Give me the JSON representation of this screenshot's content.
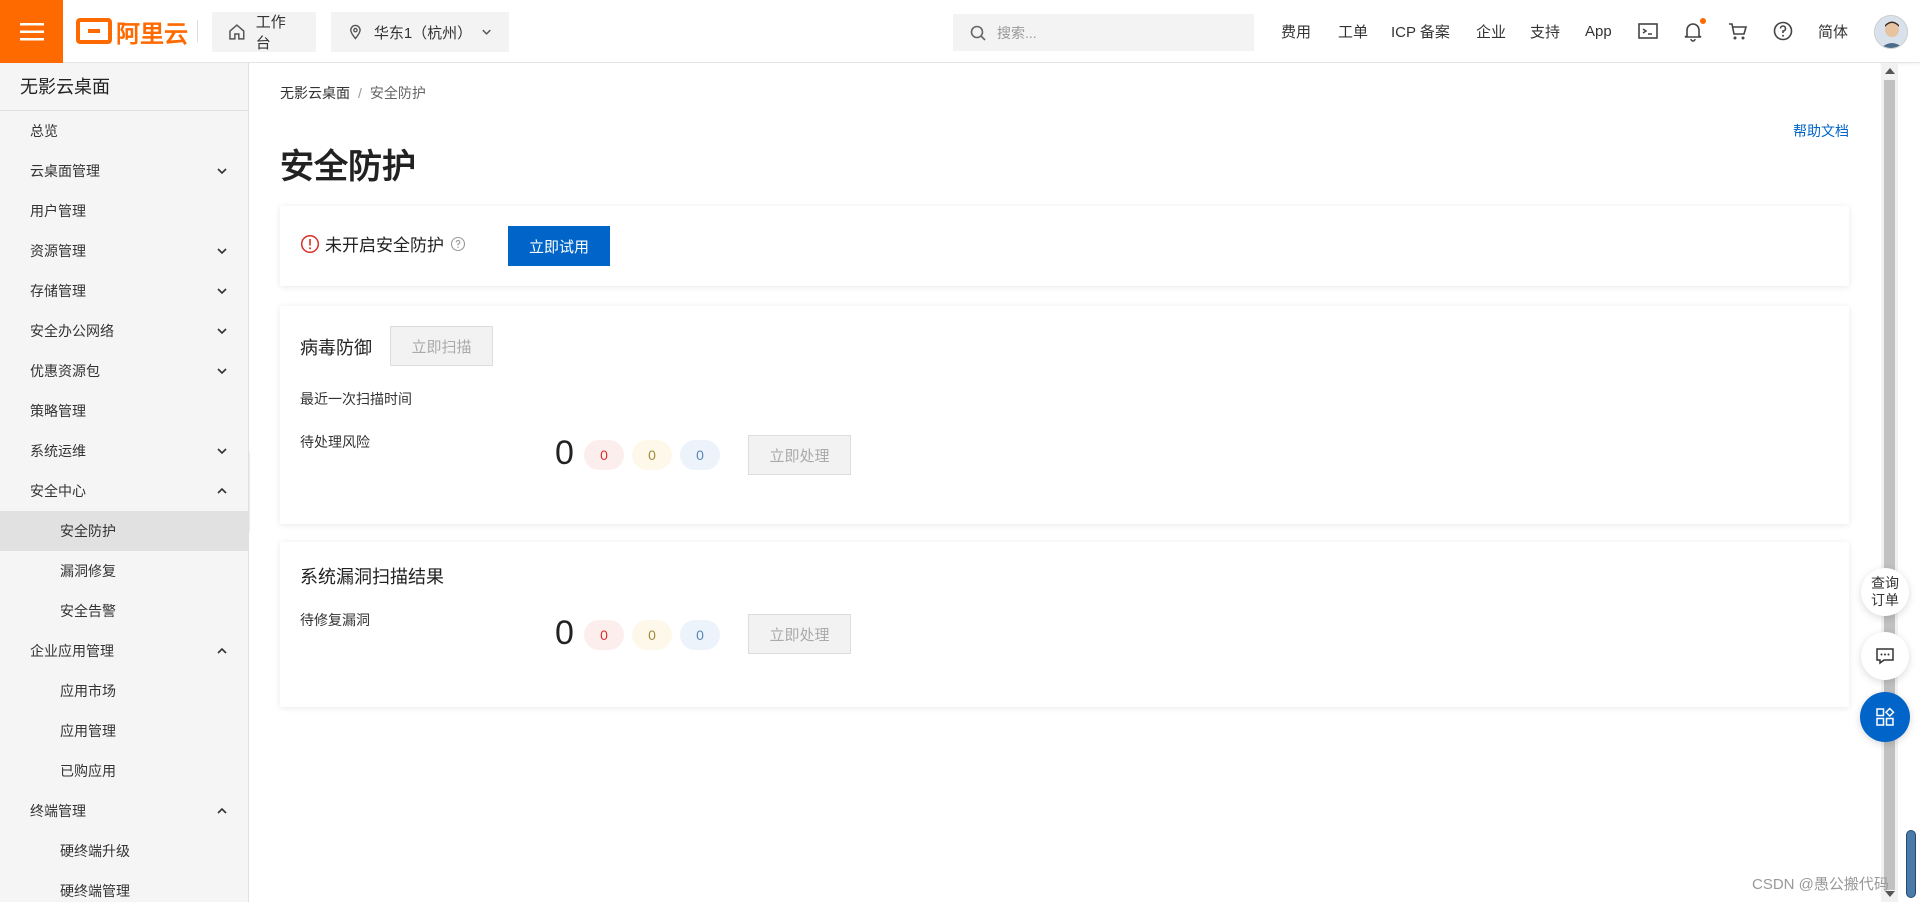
{
  "topbar": {
    "logo_text": "阿里云",
    "workbench_label": "工作台",
    "region_label": "华东1（杭州）",
    "search_placeholder": "搜索...",
    "nav": [
      "费用",
      "工单",
      "ICP 备案",
      "企业",
      "支持",
      "App"
    ],
    "lang_label": "简体",
    "accent_color": "#ff6a00"
  },
  "sidebar": {
    "title": "无影云桌面",
    "items": [
      {
        "label": "总览",
        "arrow": ""
      },
      {
        "label": "云桌面管理",
        "arrow": "down"
      },
      {
        "label": "用户管理",
        "arrow": ""
      },
      {
        "label": "资源管理",
        "arrow": "down"
      },
      {
        "label": "存储管理",
        "arrow": "down"
      },
      {
        "label": "安全办公网络",
        "arrow": "down"
      },
      {
        "label": "优惠资源包",
        "arrow": "down"
      },
      {
        "label": "策略管理",
        "arrow": ""
      },
      {
        "label": "系统运维",
        "arrow": "down"
      },
      {
        "label": "安全中心",
        "arrow": "up"
      },
      {
        "label": "安全防护",
        "sub": true,
        "active": true
      },
      {
        "label": "漏洞修复",
        "sub": true
      },
      {
        "label": "安全告警",
        "sub": true
      },
      {
        "label": "企业应用管理",
        "arrow": "up"
      },
      {
        "label": "应用市场",
        "sub": true
      },
      {
        "label": "应用管理",
        "sub": true
      },
      {
        "label": "已购应用",
        "sub": true
      },
      {
        "label": "终端管理",
        "arrow": "up"
      },
      {
        "label": "硬终端升级",
        "sub": true
      },
      {
        "label": "硬终端管理",
        "sub": true
      }
    ]
  },
  "main": {
    "breadcrumb_root": "无影云桌面",
    "breadcrumb_sep": "/",
    "breadcrumb_current": "安全防护",
    "help_link": "帮助文档",
    "page_title": "安全防护",
    "protection": {
      "status_text": "未开启安全防护",
      "try_button": "立即试用",
      "primary_color": "#0064c8"
    },
    "virus": {
      "title": "病毒防御",
      "scan_button": "立即扫描",
      "last_scan_label": "最近一次扫描时间",
      "pending_label": "待处理风险",
      "total": "0",
      "high": "0",
      "medium": "0",
      "low": "0",
      "handle_button": "立即处理"
    },
    "vuln": {
      "title": "系统漏洞扫描结果",
      "pending_label": "待修复漏洞",
      "total": "0",
      "high": "0",
      "medium": "0",
      "low": "0",
      "handle_button": "立即处理"
    }
  },
  "floating": {
    "order_line1": "查询",
    "order_line2": "订单"
  },
  "watermark": "CSDN @愚公搬代码"
}
